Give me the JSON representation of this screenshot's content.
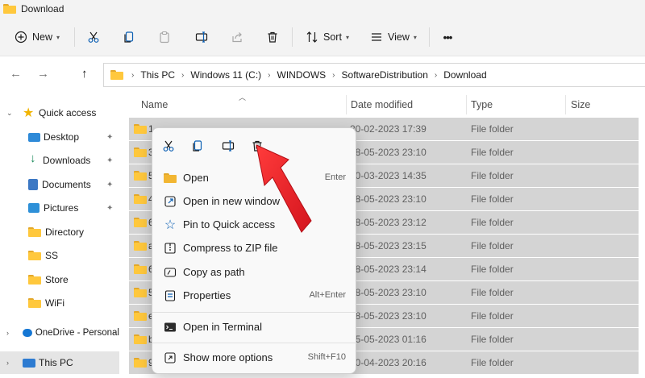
{
  "window": {
    "title": "Download"
  },
  "toolbar": {
    "new_label": "New",
    "sort_label": "Sort",
    "view_label": "View",
    "more_label": "•••"
  },
  "address": {
    "crumbs": [
      "This PC",
      "Windows 11 (C:)",
      "WINDOWS",
      "SoftwareDistribution",
      "Download"
    ]
  },
  "sidebar": {
    "items": [
      {
        "label": "Quick access"
      },
      {
        "label": "Desktop"
      },
      {
        "label": "Downloads"
      },
      {
        "label": "Documents"
      },
      {
        "label": "Pictures"
      },
      {
        "label": "Directory"
      },
      {
        "label": "SS"
      },
      {
        "label": "Store"
      },
      {
        "label": "WiFi"
      },
      {
        "label": "OneDrive - Personal"
      },
      {
        "label": "This PC"
      }
    ]
  },
  "columns": {
    "name": "Name",
    "date": "Date modified",
    "type": "Type",
    "size": "Size"
  },
  "rows": [
    {
      "prefix": "1",
      "date": "20-02-2023 17:39",
      "type": "File folder"
    },
    {
      "prefix": "3",
      "date": "18-05-2023 23:10",
      "type": "File folder"
    },
    {
      "prefix": "5",
      "date": "20-03-2023 14:35",
      "type": "File folder"
    },
    {
      "prefix": "4",
      "date": "18-05-2023 23:10",
      "type": "File folder"
    },
    {
      "prefix": "6",
      "date": "18-05-2023 23:12",
      "type": "File folder"
    },
    {
      "prefix": "a",
      "date": "18-05-2023 23:15",
      "type": "File folder"
    },
    {
      "prefix": "6",
      "date": "18-05-2023 23:14",
      "type": "File folder"
    },
    {
      "prefix": "5",
      "date": "18-05-2023 23:10",
      "type": "File folder"
    },
    {
      "prefix": "e",
      "date": "18-05-2023 23:10",
      "type": "File folder"
    },
    {
      "prefix": "b",
      "date": "15-05-2023 01:16",
      "type": "File folder"
    },
    {
      "prefix": "9",
      "date": "20-04-2023 20:16",
      "type": "File folder"
    }
  ],
  "context_menu": {
    "items": [
      {
        "label": "Open",
        "shortcut": "Enter"
      },
      {
        "label": "Open in new window",
        "shortcut": ""
      },
      {
        "label": "Pin to Quick access",
        "shortcut": ""
      },
      {
        "label": "Compress to ZIP file",
        "shortcut": ""
      },
      {
        "label": "Copy as path",
        "shortcut": ""
      },
      {
        "label": "Properties",
        "shortcut": "Alt+Enter"
      },
      {
        "label": "Open in Terminal",
        "shortcut": ""
      },
      {
        "label": "Show more options",
        "shortcut": "Shift+F10"
      }
    ]
  },
  "colors": {
    "accent": "#0067c0",
    "arrow": "#e8202a",
    "selection": "#d4d4d4",
    "folder": "#ffc83d"
  }
}
